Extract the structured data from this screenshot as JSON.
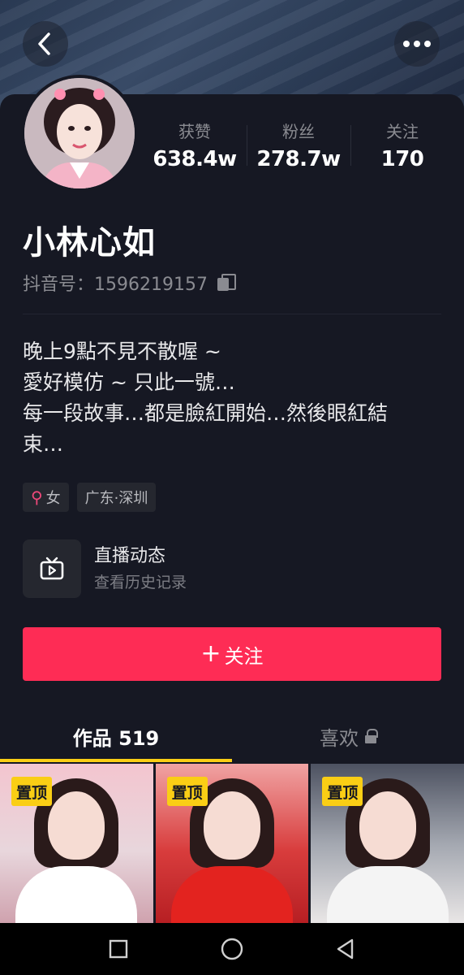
{
  "header": {
    "back_icon": "back-arrow-icon",
    "more_icon": "more-dots-icon"
  },
  "profile": {
    "avatar": "profile-avatar",
    "nickname": "小林心如",
    "douyin_id": "抖音号：1596219157",
    "stats": [
      {
        "label": "获赞",
        "value": "638.4w"
      },
      {
        "label": "粉丝",
        "value": "278.7w"
      },
      {
        "label": "关注",
        "value": "170"
      }
    ],
    "bio_lines": [
      "晚上9點不見不散喔 ~",
      "愛好模仿 ~ 只此一號…",
      "每一段故事…都是臉紅開始…然後眼紅結",
      "束…"
    ],
    "tags": {
      "gender_symbol": "⚲",
      "gender": "女",
      "location": "广东·深圳"
    }
  },
  "live": {
    "title": "直播动态",
    "subtitle": "查看历史记录"
  },
  "follow_button": {
    "plus": "+",
    "label": "关注"
  },
  "tabs": {
    "works": "作品 519",
    "likes": "喜欢"
  },
  "videos": [
    {
      "badge": "置顶"
    },
    {
      "badge": "置顶"
    },
    {
      "badge": "置顶"
    }
  ],
  "colors": {
    "background": "#161823",
    "accent": "#fe2c55",
    "pin_badge": "#face15",
    "muted_text": "#8a8b91"
  }
}
